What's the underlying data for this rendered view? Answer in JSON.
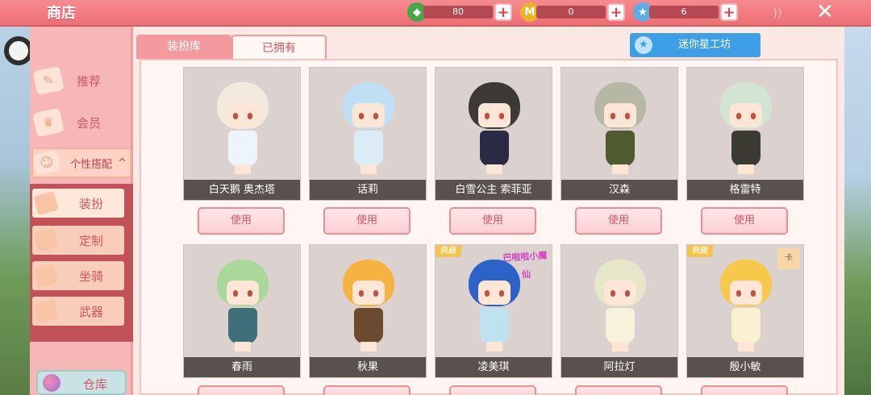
{
  "header": {
    "title": "商店",
    "resources": [
      {
        "icon": "green-gem-icon",
        "value": "80",
        "color": "#4caf50"
      },
      {
        "icon": "gold-coin-icon",
        "value": "0",
        "color": "#f2c12e"
      },
      {
        "icon": "star-coin-icon",
        "value": "6",
        "color": "#6bb6e8"
      }
    ],
    "rss_icon": "rss-icon",
    "close_icon": "close-icon"
  },
  "sidebar": {
    "items": [
      {
        "label": "推荐"
      },
      {
        "label": "会员"
      },
      {
        "label": "个性搭配"
      }
    ],
    "sub_items": [
      {
        "label": "装扮"
      },
      {
        "label": "定制"
      },
      {
        "label": "坐骑"
      },
      {
        "label": "武器"
      }
    ],
    "warehouse": "仓库"
  },
  "tabs": [
    {
      "label": "装扮库"
    },
    {
      "label": "已拥有"
    }
  ],
  "studio_button": "迷你星工坊",
  "use_label": "使用",
  "row1": [
    {
      "name": "白天鹅 奥杰塔",
      "hair": "#f3e9df",
      "body": "#eef4fb"
    },
    {
      "name": "话莉",
      "hair": "#bfe0f4",
      "body": "#dcecf7"
    },
    {
      "name": "白雪公主 索菲亚",
      "hair": "#3d3a36",
      "body": "#2a2a44"
    },
    {
      "name": "汉森",
      "hair": "#b7b7a6",
      "body": "#4f5a2e"
    },
    {
      "name": "格雷特",
      "hair": "#d2e4d2",
      "body": "#3b3a32"
    }
  ],
  "row2": [
    {
      "name": "春雨",
      "hair": "#a9d89a",
      "body": "#3f6f78",
      "tag": "",
      "extra": ""
    },
    {
      "name": "秋果",
      "hair": "#f5b43f",
      "body": "#6b4a30",
      "tag": "",
      "extra": ""
    },
    {
      "name": "凌美琪",
      "hair": "#2d62c8",
      "body": "#bde3f0",
      "tag": "典藏",
      "extra": "logo"
    },
    {
      "name": "阿拉灯",
      "hair": "#e6e6c8",
      "body": "#f7f2dc",
      "tag": "",
      "extra": ""
    },
    {
      "name": "殷小敏",
      "hair": "#f7c94a",
      "body": "#fbf1d0",
      "tag": "典藏",
      "extra": "卡"
    }
  ],
  "logo_text": "巴啦啦小魔仙"
}
